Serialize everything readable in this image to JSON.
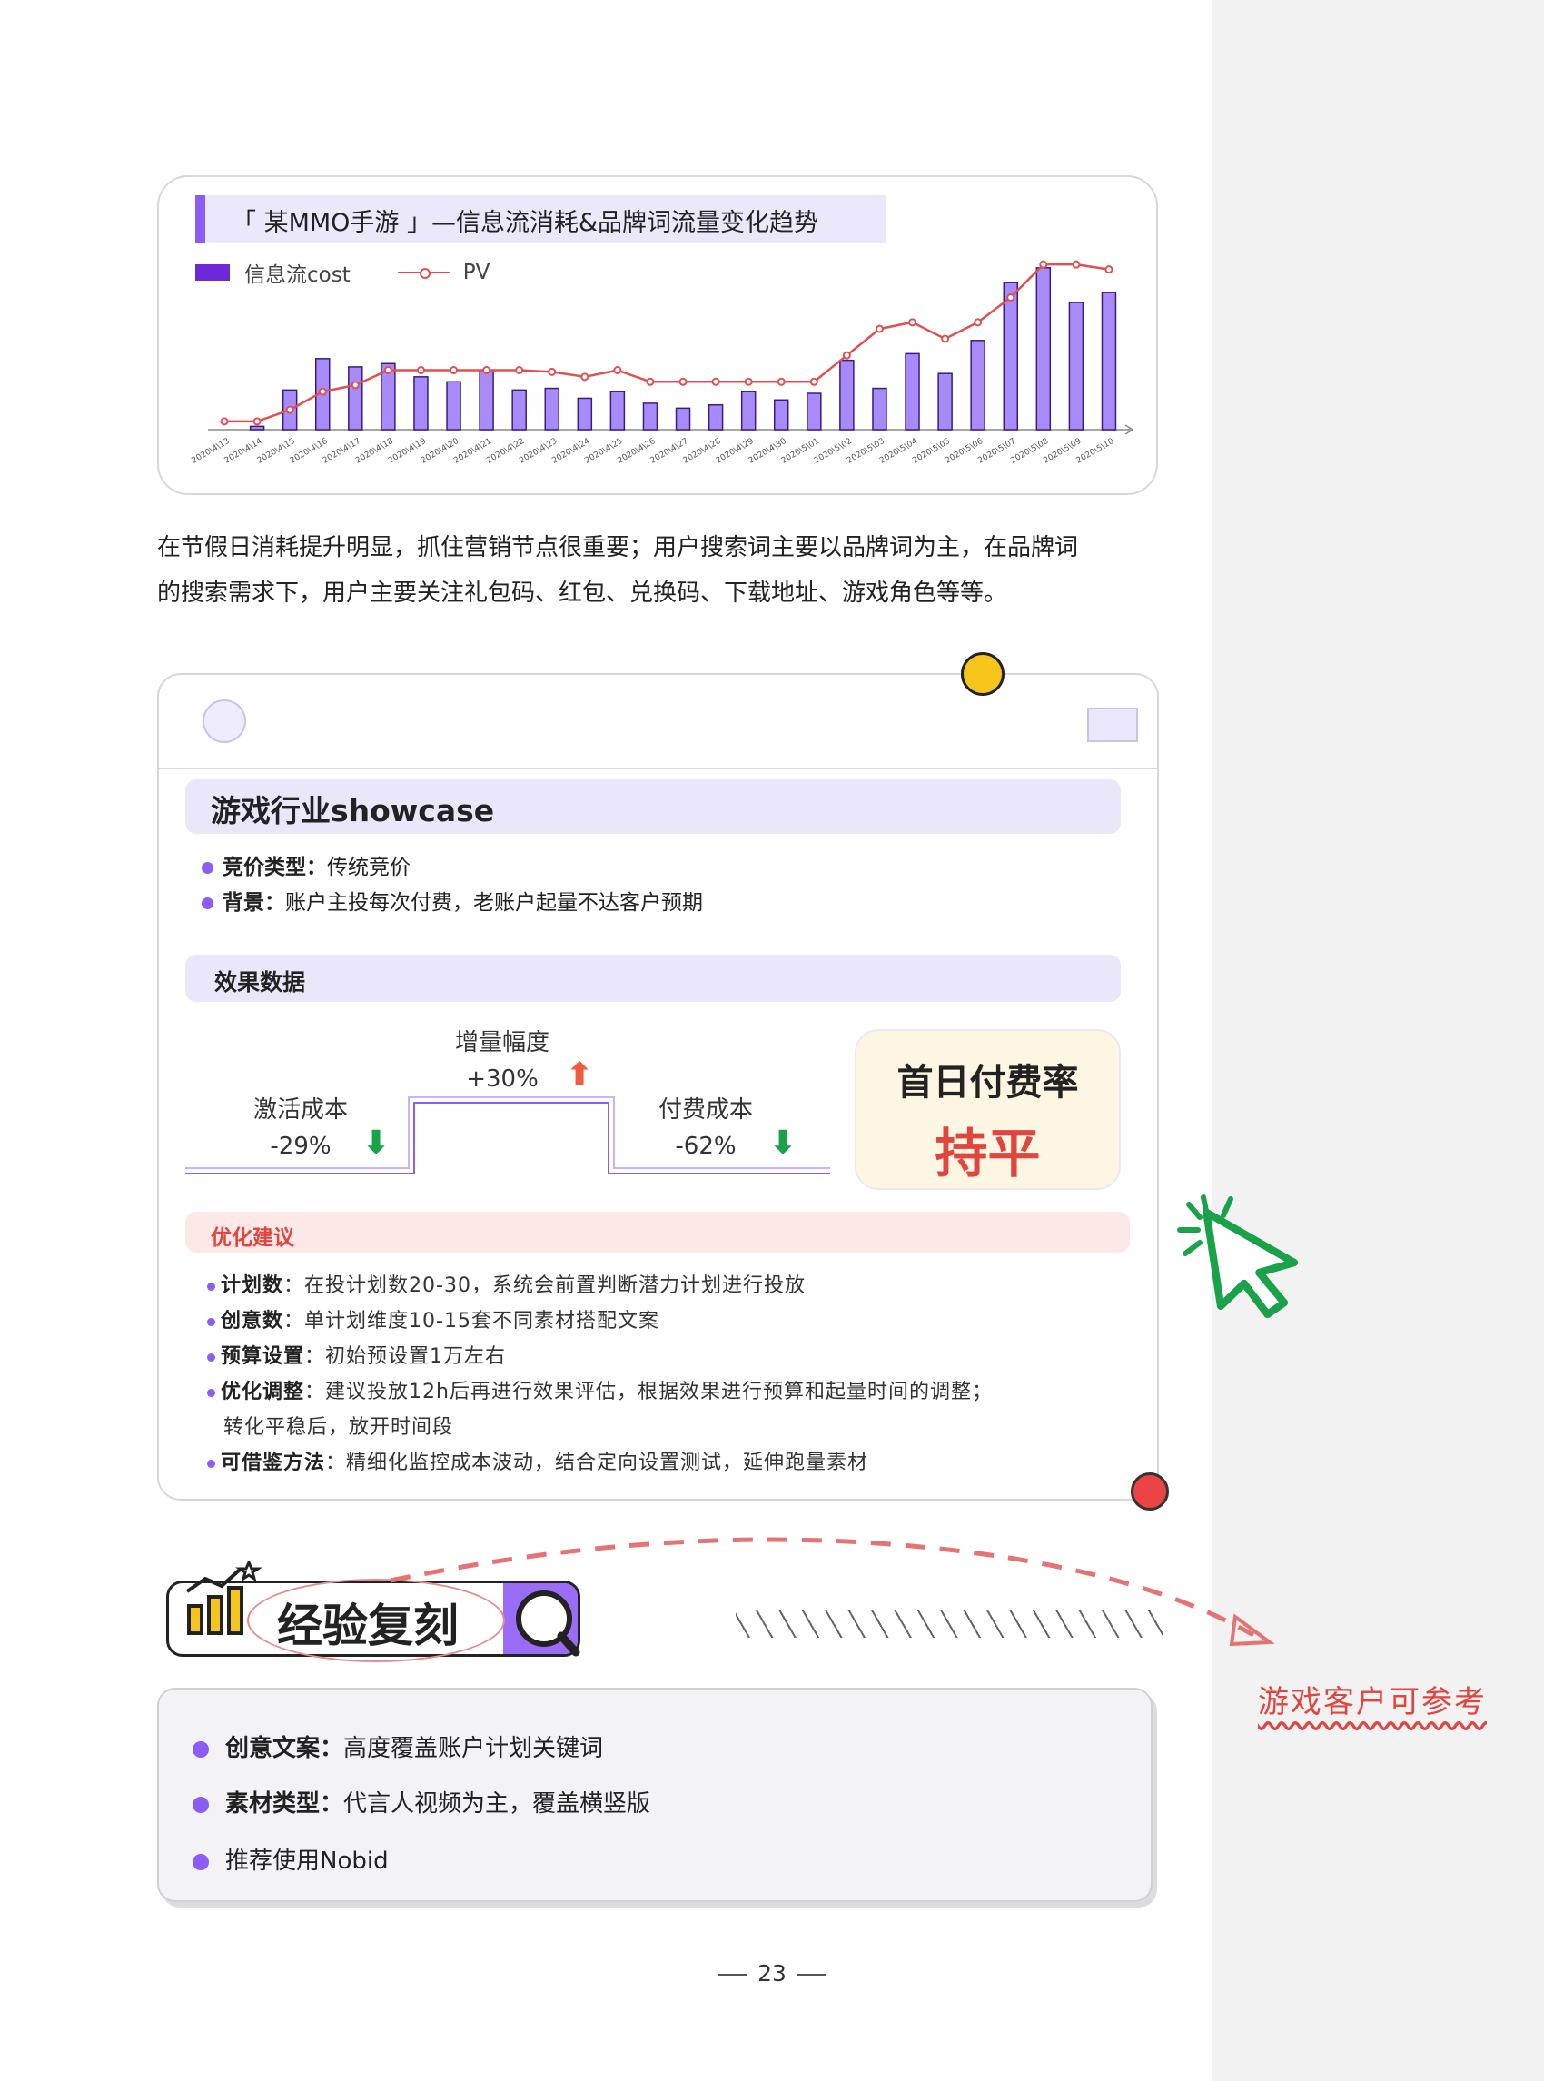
{
  "chart_data": {
    "type": "bar",
    "title": "「 某MMO手游 」—信息流消耗&品牌词流量变化趋势",
    "categories": [
      "2020\\4\\13",
      "2020\\4\\14",
      "2020\\4\\15",
      "2020\\4\\16",
      "2020\\4\\17",
      "2020\\4\\18",
      "2020\\4\\19",
      "2020\\4\\20",
      "2020\\4\\21",
      "2020\\4\\22",
      "2020\\4\\23",
      "2020\\4\\24",
      "2020\\4\\25",
      "2020\\4\\26",
      "2020\\4\\27",
      "2020\\4\\28",
      "2020\\4\\29",
      "2020\\4\\30",
      "2020\\5\\01",
      "2020\\5\\02",
      "2020\\5\\03",
      "2020\\5\\04",
      "2020\\5\\05",
      "2020\\5\\06",
      "2020\\5\\07",
      "2020\\5\\08",
      "2020\\5\\09",
      "2020\\5\\10"
    ],
    "series": [
      {
        "name": "信息流cost",
        "type": "bar",
        "color": "#a78bfa",
        "values": [
          0,
          2,
          24,
          43,
          38,
          40,
          32,
          29,
          36,
          24,
          25,
          19,
          23,
          16,
          13,
          15,
          23,
          18,
          22,
          42,
          25,
          46,
          34,
          54,
          89,
          98,
          77,
          83
        ]
      },
      {
        "name": "PV",
        "type": "line",
        "color": "#e05050",
        "values": [
          5,
          5,
          12,
          23,
          27,
          36,
          36,
          36,
          36,
          36,
          35,
          32,
          36,
          29,
          29,
          29,
          29,
          29,
          29,
          45,
          61,
          65,
          55,
          65,
          80,
          100,
          100,
          97
        ]
      }
    ],
    "ylim": [
      0,
      110
    ],
    "legend": "top-left",
    "grid": false
  },
  "intro": {
    "line1": "在节假日消耗提升明显，抓住营销节点很重要；用户搜索词主要以品牌词为主，在品牌词",
    "line2": "的搜索需求下，用户主要关注礼包码、红包、兑换码、下载地址、游戏角色等等。"
  },
  "showcase": {
    "title": "游戏行业showcase",
    "items": [
      {
        "label": "竞价类型：",
        "value": "传统竞价"
      },
      {
        "label": "背景：",
        "value": "账户主投每次付费，老账户起量不达客户预期"
      }
    ],
    "effect_title": "效果数据",
    "stats": {
      "activation": {
        "label": "激活成本",
        "value": "-29%"
      },
      "increase": {
        "label": "增量幅度",
        "value": "+30%"
      },
      "payment": {
        "label": "付费成本",
        "value": "-62%"
      }
    },
    "first_day": {
      "label": "首日付费率",
      "value": "持平"
    },
    "advice_title": "优化建议",
    "advice": [
      {
        "label": "计划数",
        "value": "：在投计划数20-30，系统会前置判断潜力计划进行投放"
      },
      {
        "label": "创意数",
        "value": "：单计划维度10-15套不同素材搭配文案"
      },
      {
        "label": "预算设置",
        "value": "：初始预设置1万左右"
      },
      {
        "label": "优化调整",
        "value": "：建议投放12h后再进行效果评估，根据效果进行预算和起量时间的调整；"
      },
      {
        "label": "",
        "value": "转化平稳后，放开时间段"
      },
      {
        "label": "可借鉴方法",
        "value": "：精细化监控成本波动，结合定向设置测试，延伸跑量素材"
      }
    ]
  },
  "experience": {
    "title": "经验复刻",
    "items": [
      {
        "label": "创意文案：",
        "value": "高度覆盖账户计划关键词"
      },
      {
        "label": "素材类型：",
        "value": "代言人视频为主，覆盖横竖版"
      },
      {
        "label": "",
        "value": "推荐使用Nobid"
      }
    ],
    "side_note": "游戏客户可参考"
  },
  "page_number": "23"
}
